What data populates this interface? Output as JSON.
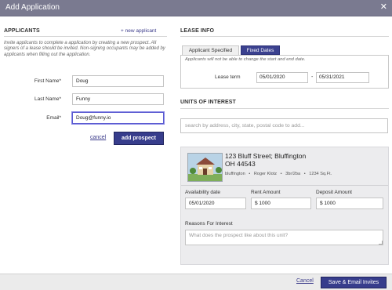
{
  "dialog": {
    "title": "Add Application",
    "close_icon": "close-icon"
  },
  "applicants": {
    "heading": "APPLICANTS",
    "new_applicant_link": "+ new applicant",
    "intro_text": "Invite applicants to complete a application by creating a new prospect. All signers of a lease should be invited. Non-signing occupants may be added by applicants when filling out the application.",
    "first_name": {
      "label": "First Name*",
      "value": "Doug"
    },
    "last_name": {
      "label": "Last Name*",
      "value": "Funny"
    },
    "email": {
      "label": "Email*",
      "value": "Doug@funny.io"
    },
    "cancel_label": "cancel",
    "add_prospect_label": "add prospect"
  },
  "lease_info": {
    "heading": "LEASE INFO",
    "tabs": [
      {
        "label": "Applicant Specified",
        "active": false
      },
      {
        "label": "Fixed Dates",
        "active": true
      }
    ],
    "note": "Applicants will not be able to change the start and end date.",
    "term_label": "Lease term",
    "start_date": "05/01/2020",
    "separator": "-",
    "end_date": "05/31/2021"
  },
  "units": {
    "heading": "UNITS OF INTEREST",
    "search_placeholder": "search by address, city, state, postal code to add...",
    "unit": {
      "address_line1": "123 Bluff Street; Bluffington",
      "address_line2": "OH 44543",
      "meta": {
        "city": "bluffington",
        "owner": "Roger Klotz",
        "beds_baths": "3br/2ba",
        "size": "1234 Sq.Ft.",
        "separator": "•"
      },
      "availability": {
        "label": "Availability date",
        "value": "05/01/2020"
      },
      "rent": {
        "label": "Rent Amount",
        "value": "$ 1000"
      },
      "deposit": {
        "label": "Deposit Amount",
        "value": "$ 1000"
      },
      "reasons": {
        "label": "Reasons For Interest",
        "placeholder": "What does the prospect like about this unit?"
      }
    }
  },
  "footer": {
    "cancel_label": "Cancel",
    "submit_label": "Save & Email Invites"
  },
  "colors": {
    "title_bar": "#7a7a90",
    "primary": "#373d8c",
    "link": "#3b3b8a"
  }
}
